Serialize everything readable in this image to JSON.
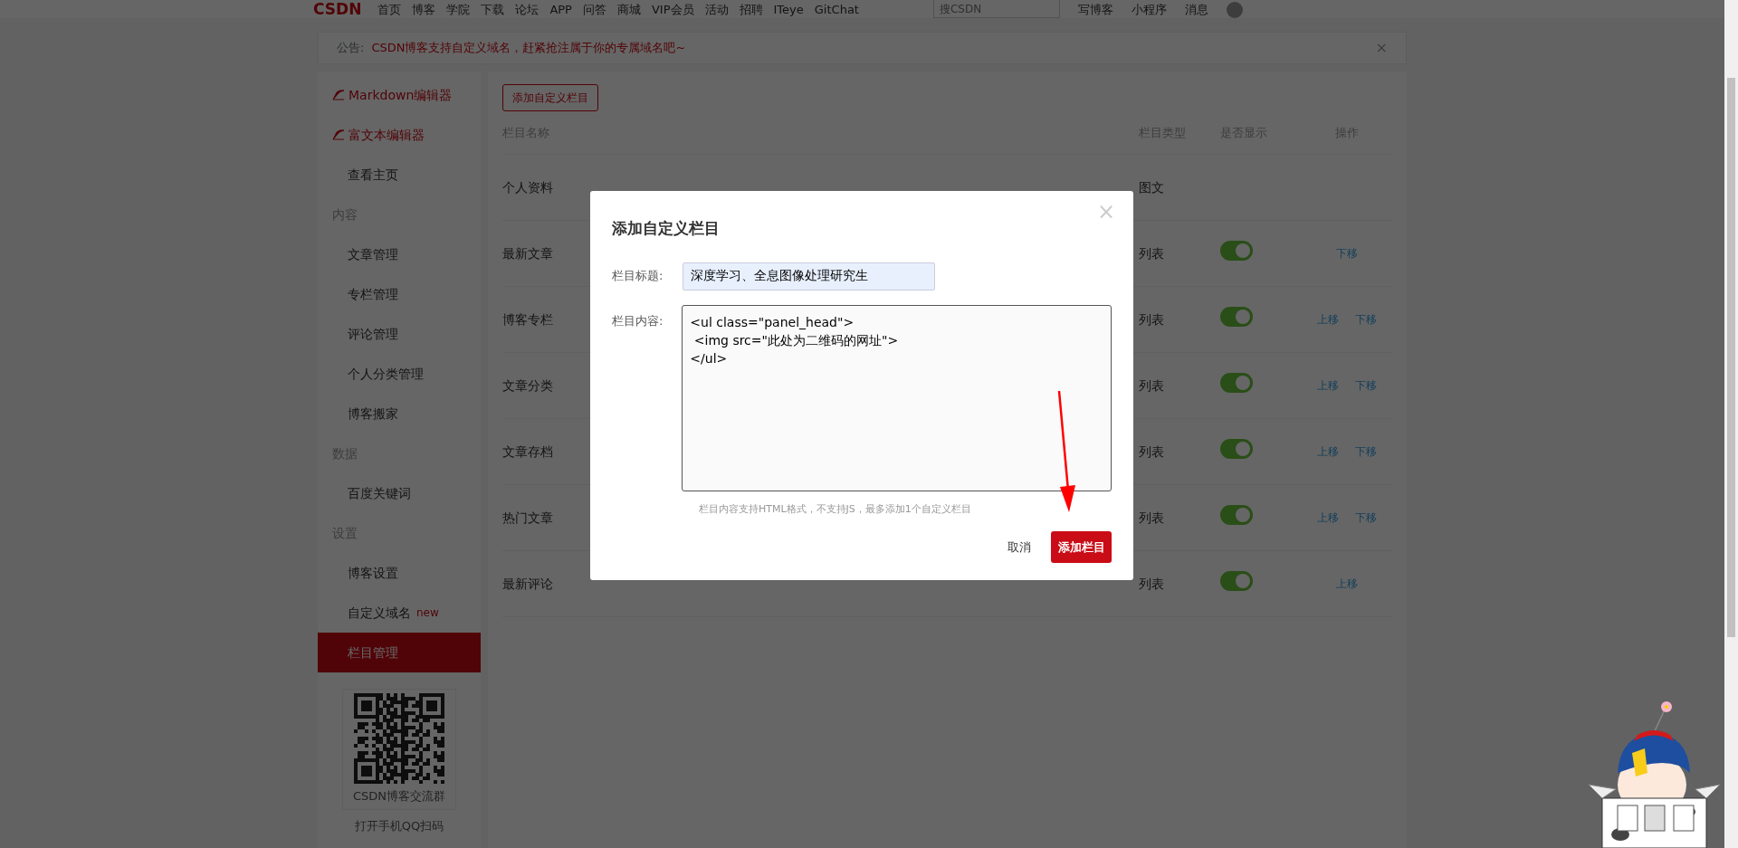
{
  "nav": {
    "logo": "CSDN",
    "links": [
      "首页",
      "博客",
      "学院",
      "下载",
      "论坛",
      "APP",
      "问答",
      "商城",
      "VIP会员",
      "活动",
      "招聘",
      "ITeye",
      "GitChat"
    ],
    "search": {
      "placeholder": "搜CSDN"
    },
    "actions": [
      "写博客",
      "小程序",
      "消息"
    ]
  },
  "announcement": {
    "label": "公告:",
    "text": "CSDN博客支持自定义域名，赶紧抢注属于你的专属域名吧~",
    "close": "×"
  },
  "sidebar": {
    "items": [
      {
        "kind": "editor",
        "label": "Markdown编辑器",
        "selected": false
      },
      {
        "kind": "editor",
        "label": "富文本编辑器",
        "selected": false
      },
      {
        "kind": "link",
        "label": "查看主页",
        "selected": false
      },
      {
        "kind": "section",
        "label": "内容",
        "selected": false
      },
      {
        "kind": "link",
        "label": "文章管理",
        "selected": false
      },
      {
        "kind": "link",
        "label": "专栏管理",
        "selected": false
      },
      {
        "kind": "link",
        "label": "评论管理",
        "selected": false
      },
      {
        "kind": "link",
        "label": "个人分类管理",
        "selected": false
      },
      {
        "kind": "link",
        "label": "博客搬家",
        "selected": false
      },
      {
        "kind": "section",
        "label": "数据",
        "selected": false
      },
      {
        "kind": "link",
        "label": "百度关键词",
        "selected": false
      },
      {
        "kind": "section",
        "label": "设置",
        "selected": false
      },
      {
        "kind": "link",
        "label": "博客设置",
        "selected": false
      },
      {
        "kind": "link",
        "label": "自定义域名",
        "badge": "new",
        "selected": false
      },
      {
        "kind": "link",
        "label": "栏目管理",
        "selected": true
      }
    ],
    "qr": {
      "caption": "CSDN博客交流群",
      "hint": "打开手机QQ扫码"
    }
  },
  "content": {
    "add_button": "添加自定义栏目",
    "columns": [
      "栏目名称",
      "栏目类型",
      "是否显示",
      "操作"
    ],
    "rows": [
      {
        "name": "个人资料",
        "type": "图文"
      },
      {
        "name": "最新文章",
        "type": "列表",
        "on": true,
        "actions": [
          "下移"
        ]
      },
      {
        "name": "博客专栏",
        "type": "列表",
        "on": true,
        "actions": [
          "上移",
          "下移"
        ]
      },
      {
        "name": "文章分类",
        "type": "列表",
        "on": true,
        "actions": [
          "上移",
          "下移"
        ]
      },
      {
        "name": "文章存档",
        "type": "列表",
        "on": true,
        "actions": [
          "上移",
          "下移"
        ]
      },
      {
        "name": "热门文章",
        "type": "列表",
        "on": true,
        "actions": [
          "上移",
          "下移"
        ]
      },
      {
        "name": "最新评论",
        "type": "列表",
        "on": true,
        "actions": [
          "上移"
        ]
      }
    ]
  },
  "modal": {
    "title": "添加自定义栏目",
    "close": "×",
    "title_label": "栏目标题:",
    "title_value": "深度学习、全息图像处理研究生",
    "content_label": "栏目内容:",
    "content_value": "<ul class=\"panel_head\">\n <img src=\"此处为二维码的网址\">\n</ul>",
    "help": "栏目内容支持HTML格式，不支持JS，最多添加1个自定义栏目",
    "cancel": "取消",
    "submit": "添加栏目"
  }
}
